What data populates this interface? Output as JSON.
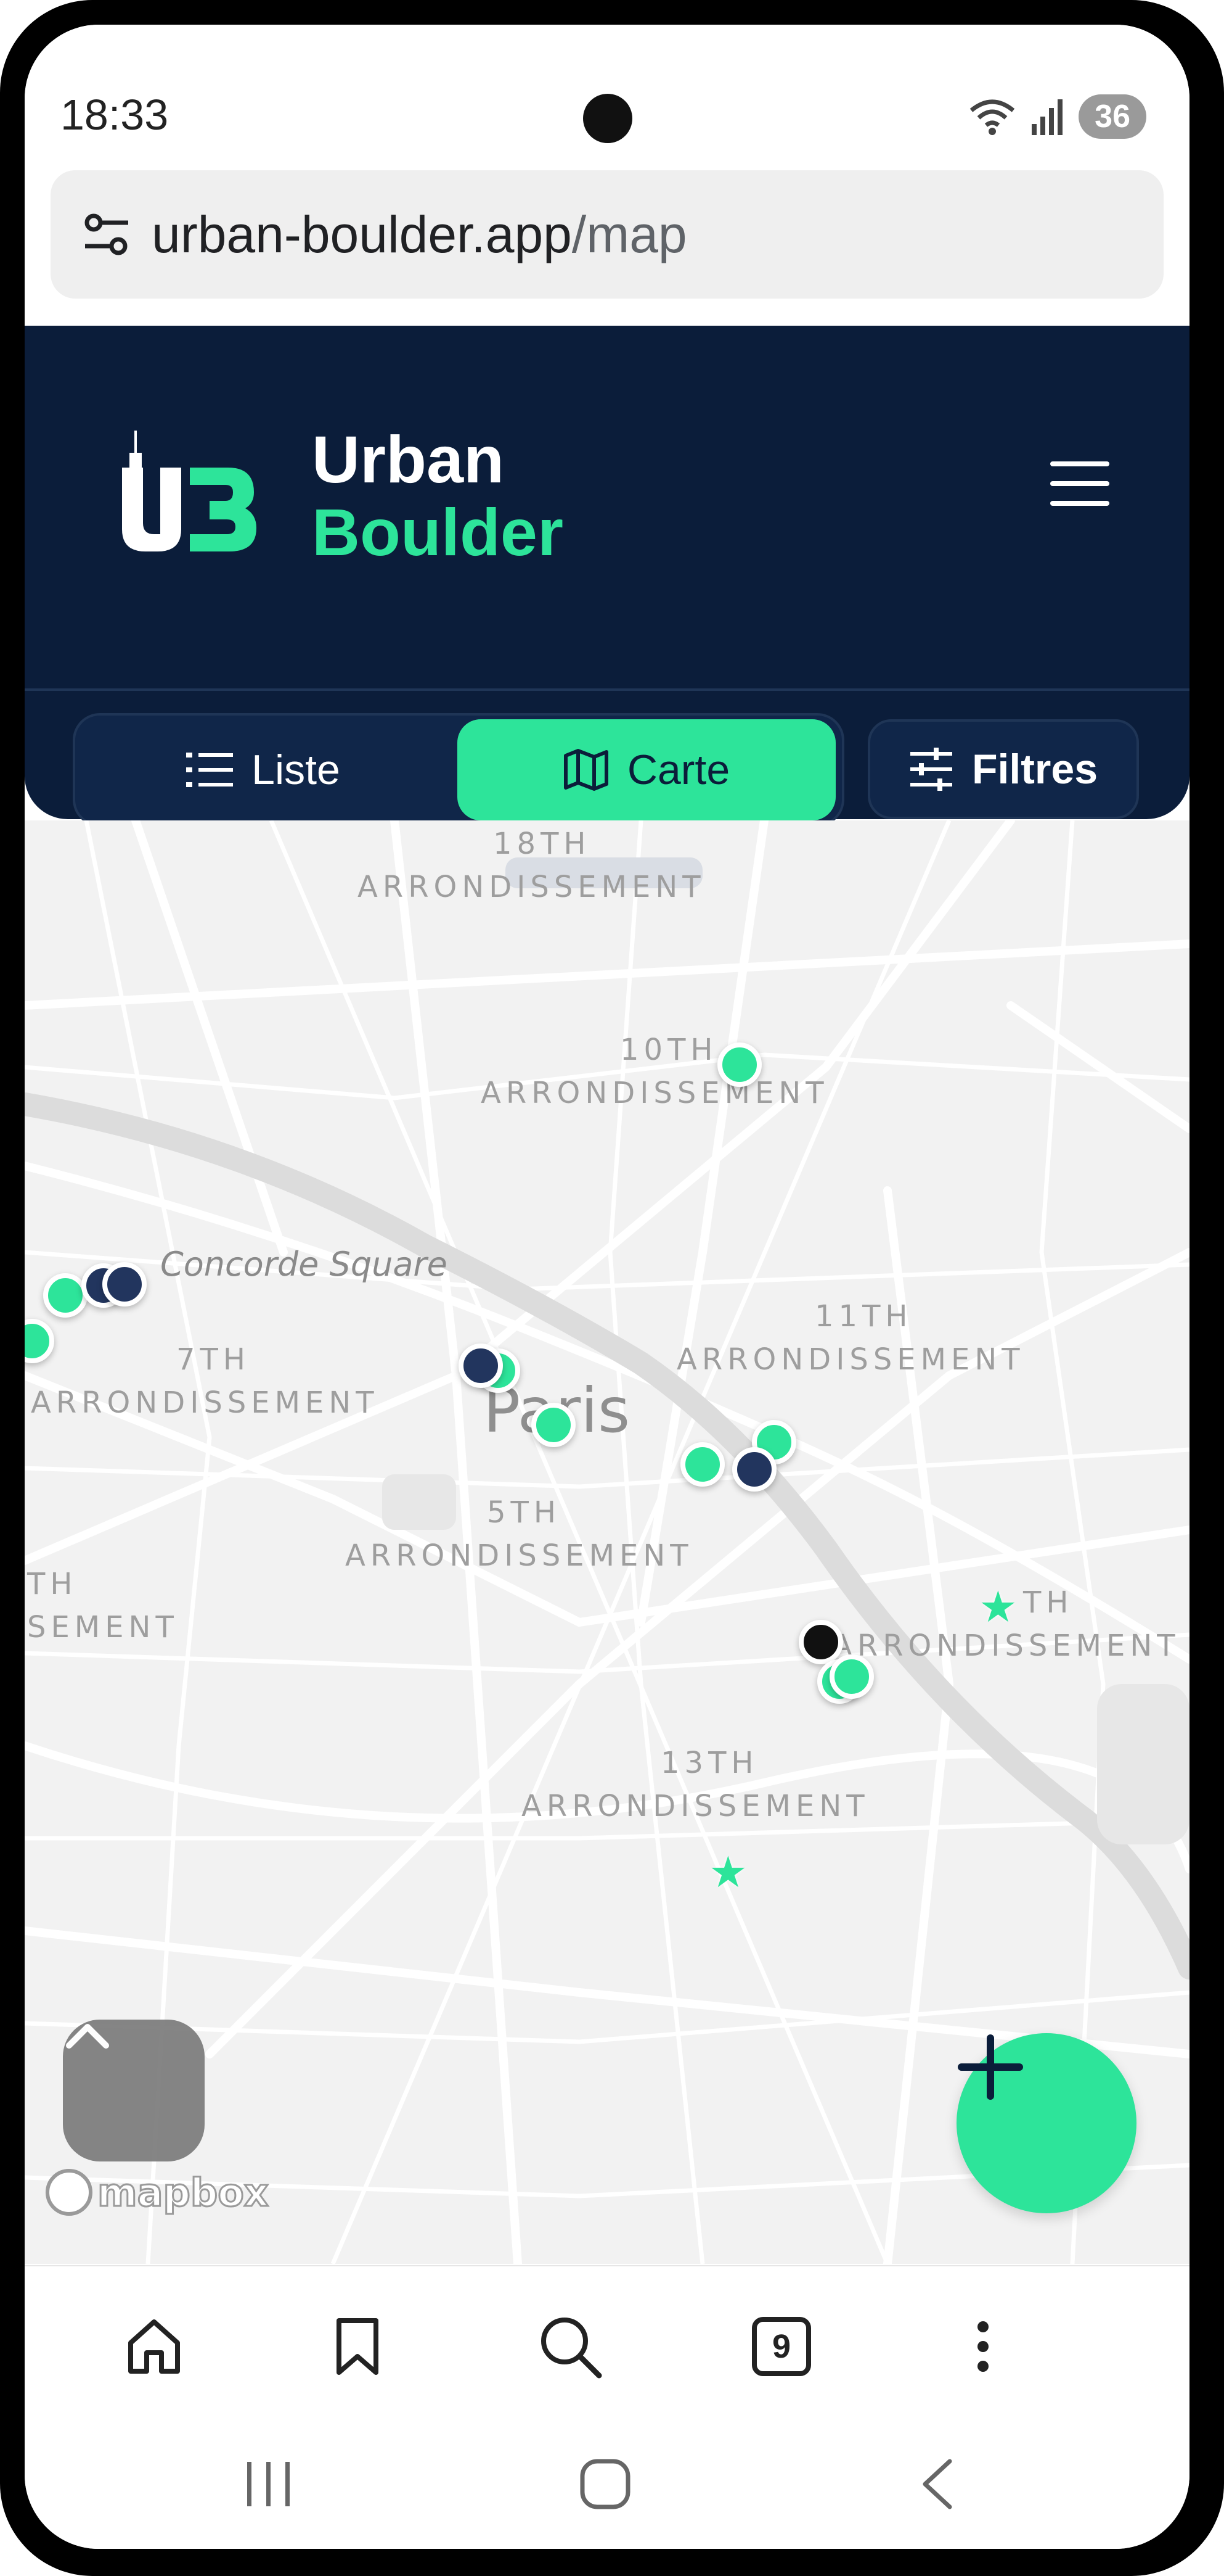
{
  "status_bar": {
    "time": "18:33",
    "battery": "36"
  },
  "browser": {
    "url_domain": "urban-boulder.app",
    "url_path": "/map",
    "tab_count": "9"
  },
  "header": {
    "brand_line1": "Urban",
    "brand_line2": "Boulder",
    "logo_text": "UB",
    "accent_color": "#2de49a",
    "background_color": "#0b1d3a"
  },
  "view_toggle": {
    "list_label": "Liste",
    "map_label": "Carte",
    "active": "Carte"
  },
  "filters_label": "Filtres",
  "map": {
    "labels": {
      "arr18_a": "18TH",
      "arr18_b": "ARRONDISSEMENT",
      "arr10_a": "10TH",
      "arr10_b": "ARRONDISSEMENT",
      "concorde": "Concorde Square",
      "arr7_a": "7TH",
      "arr7_b": "ARRONDISSEMENT",
      "arr11_a": "11TH",
      "arr11_b": "ARRONDISSEMENT",
      "paris": "Paris",
      "arr5_a": "5TH",
      "arr5_b": "ARRONDISSEMENT",
      "arr15_a": "TH",
      "arr15_b": "SEMENT",
      "arr12_a": "TH",
      "arr12_b": "ARRONDISSEMENT",
      "arr13_a": "13TH",
      "arr13_b": "ARRONDISSEMENT"
    },
    "attribution": "mapbox",
    "pin_colors": {
      "green": "#2de49a",
      "navy": "#22355e",
      "black": "#111111"
    }
  },
  "icons": {
    "address_settings": "tune-icon",
    "list": "list-icon",
    "map": "map-icon",
    "filters": "sliders-icon",
    "menu": "hamburger-icon",
    "up": "chevron-up-icon",
    "add": "plus-icon",
    "home": "home-icon",
    "bookmark": "bookmark-icon",
    "search": "search-icon",
    "more": "more-vertical-icon"
  }
}
